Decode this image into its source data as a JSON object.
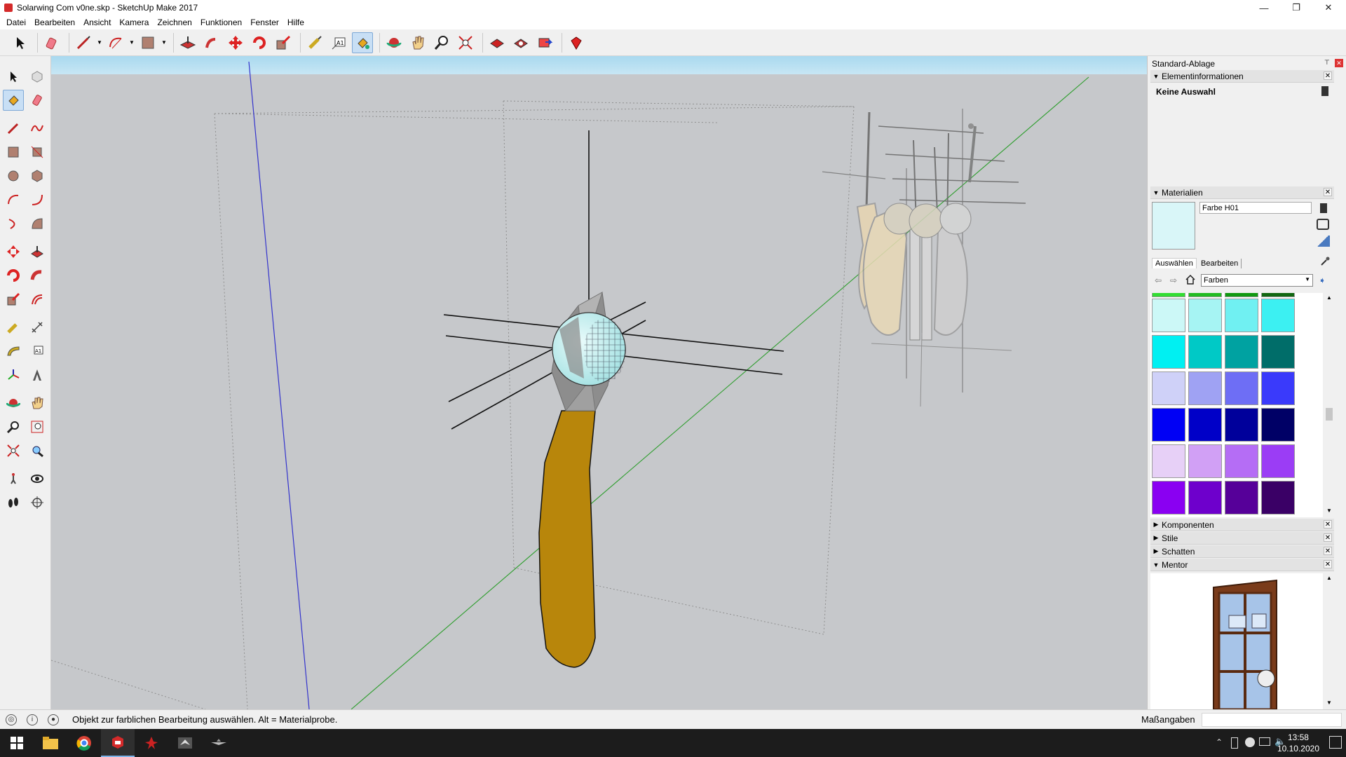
{
  "window": {
    "title": "Solarwing Com v0ne.skp - SketchUp Make 2017",
    "controls": [
      "—",
      "❐",
      "✕"
    ]
  },
  "menu": [
    "Datei",
    "Bearbeiten",
    "Ansicht",
    "Kamera",
    "Zeichnen",
    "Funktionen",
    "Fenster",
    "Hilfe"
  ],
  "tray": {
    "title": "Standard-Ablage",
    "entity_info": {
      "header": "Elementinformationen",
      "selection": "Keine Auswahl"
    },
    "materials": {
      "header": "Materialien",
      "current_name": "Farbe H01",
      "current_color": "#d9f6f8",
      "tab_select": "Auswählen",
      "tab_edit": "Bearbeiten",
      "library": "Farben",
      "swatches": [
        [
          "#ccf8f7",
          "#a6f4f3",
          "#70f0f2",
          "#3cf0f2"
        ],
        [
          "#00f0f2",
          "#00c9c6",
          "#00a2a1",
          "#006d69"
        ],
        [
          "#cfd1f8",
          "#9fa2f3",
          "#6e6ef5",
          "#3a3afb"
        ],
        [
          "#0000f5",
          "#0000c8",
          "#00009b",
          "#000066"
        ],
        [
          "#e7d0f7",
          "#d1a0f5",
          "#b56df5",
          "#9b3df5"
        ],
        [
          "#8a00f2",
          "#6e00cc",
          "#560099",
          "#3a0066"
        ],
        [
          "#fbd0f5",
          "#f7a2ef",
          "#f56ee8",
          "#f23ee6"
        ]
      ],
      "top_partial": [
        "#33dd33",
        "#22bb22",
        "#119911",
        "#116611"
      ],
      "bottom_partial": [
        "#ee00cc",
        "#bb00aa",
        "#990088",
        "#660066"
      ]
    },
    "collapsed": [
      "Komponenten",
      "Stile",
      "Schatten"
    ],
    "mentor": {
      "header": "Mentor"
    }
  },
  "status": {
    "message": "Objekt zur farblichen Bearbeitung auswählen. Alt = Materialprobe.",
    "measure_label": "Maßangaben"
  },
  "taskbar": {
    "time": "13:58",
    "date": "10.10.2020"
  }
}
